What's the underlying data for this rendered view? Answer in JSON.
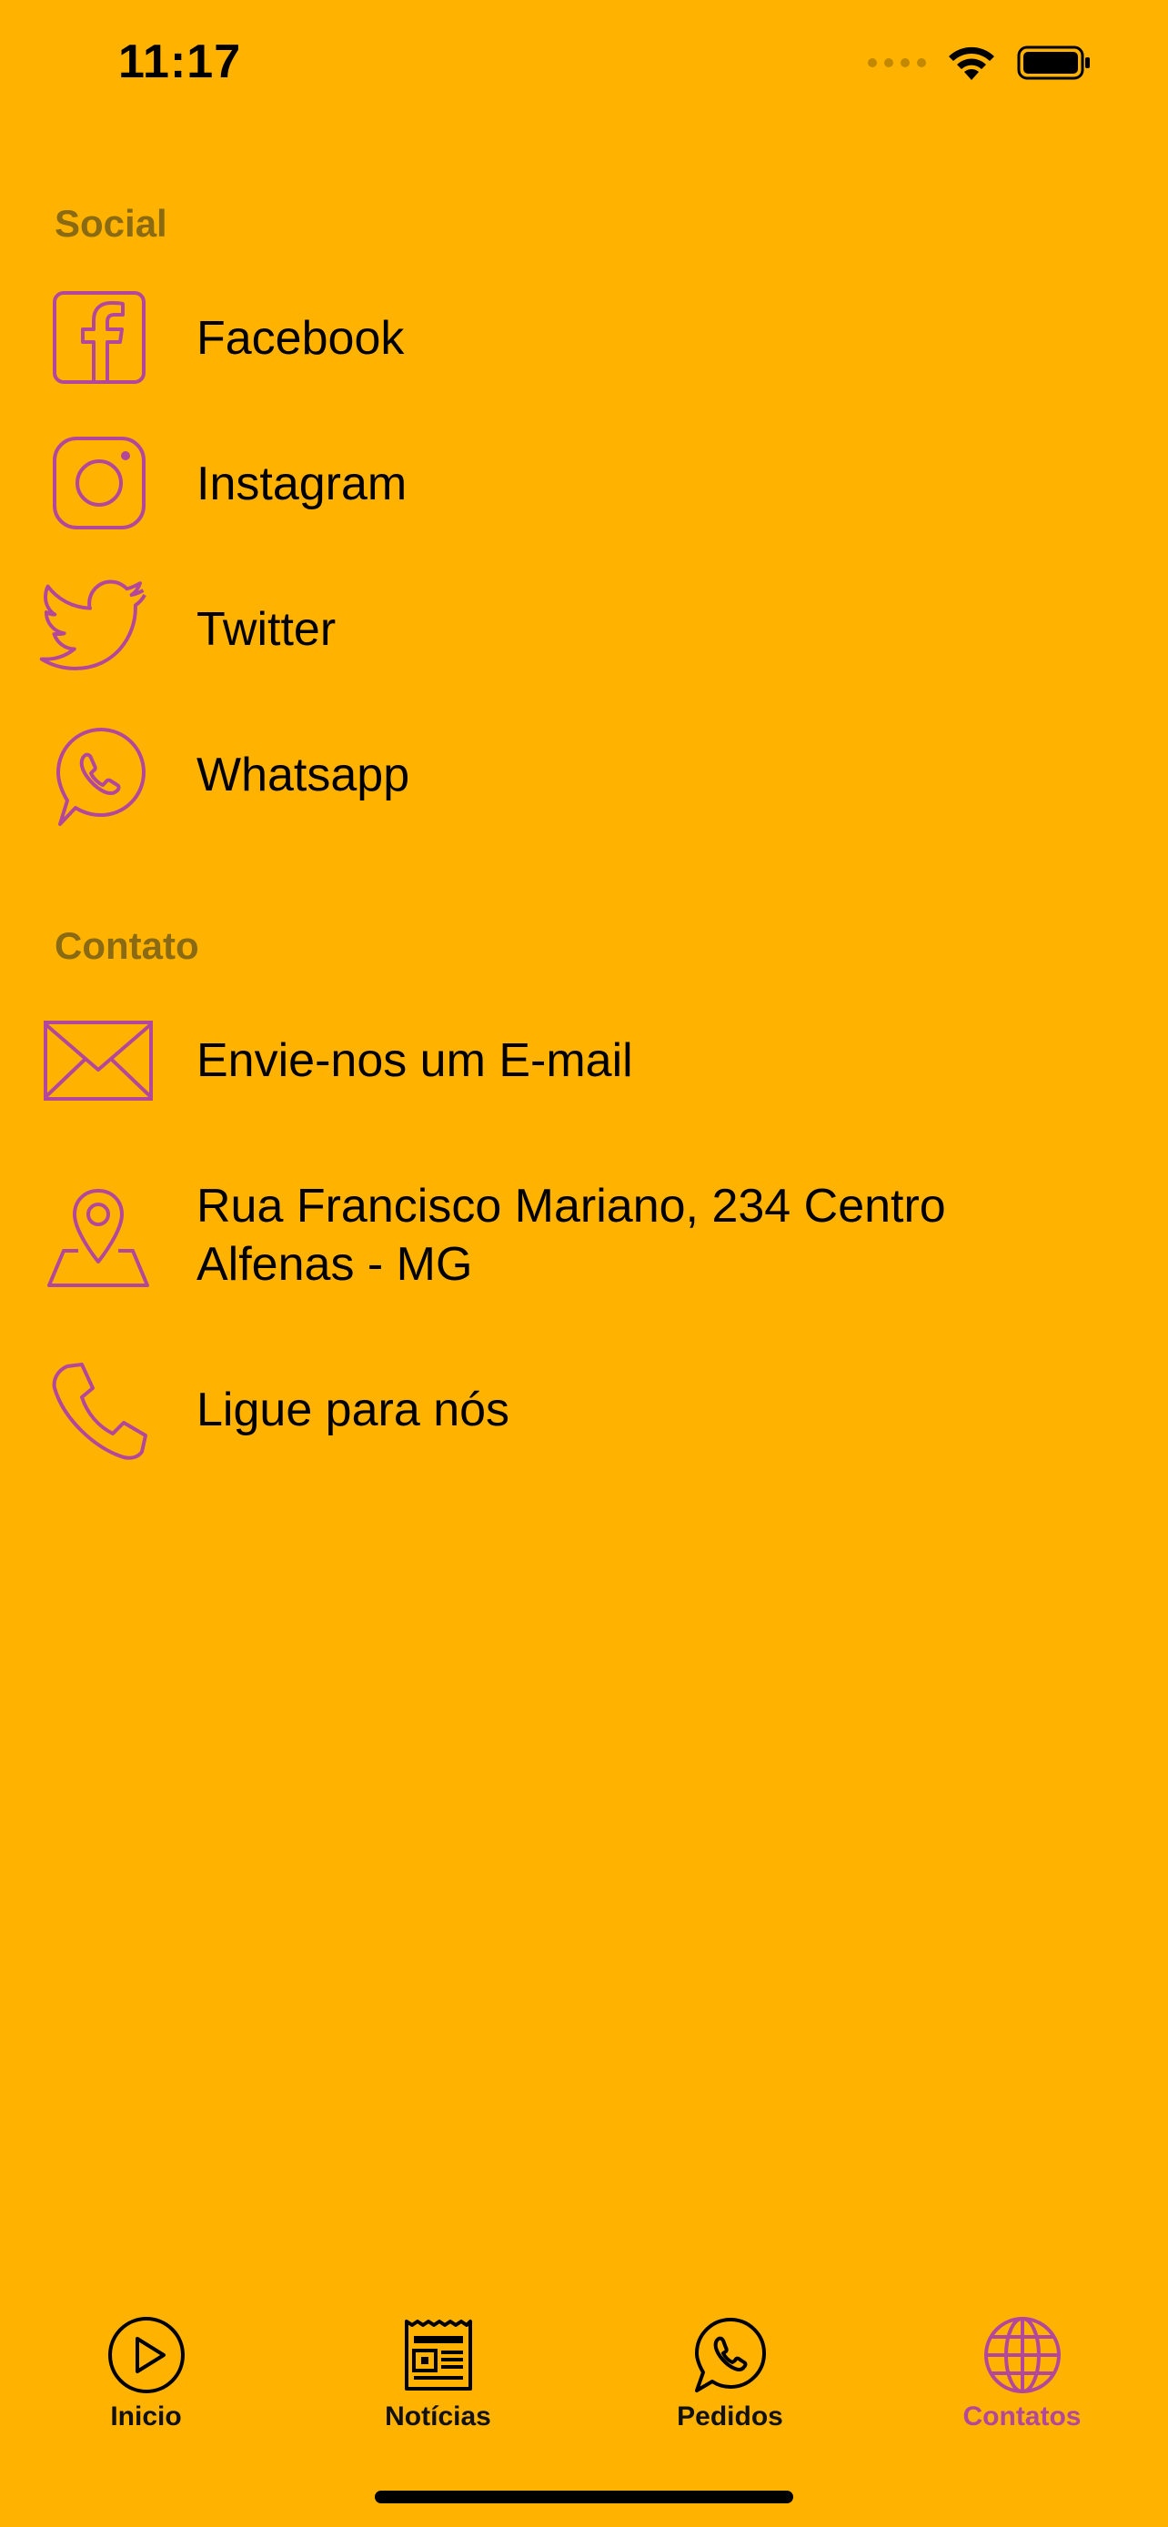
{
  "status_bar": {
    "time": "11:17"
  },
  "colors": {
    "background": "#FFB300",
    "accent": "#B3479A",
    "section_header": "#8a6a12"
  },
  "social": {
    "header": "Social",
    "items": [
      {
        "label": "Facebook",
        "icon": "facebook-icon"
      },
      {
        "label": "Instagram",
        "icon": "instagram-icon"
      },
      {
        "label": "Twitter",
        "icon": "twitter-icon"
      },
      {
        "label": "Whatsapp",
        "icon": "whatsapp-icon"
      }
    ]
  },
  "contato": {
    "header": "Contato",
    "items": [
      {
        "label": "Envie-nos um E-mail",
        "icon": "mail-icon"
      },
      {
        "label": "Rua Francisco Mariano, 234 Centro Alfenas - MG",
        "icon": "location-pin-icon"
      },
      {
        "label": "Ligue para nós",
        "icon": "phone-icon"
      }
    ]
  },
  "tab_bar": {
    "tabs": [
      {
        "label": "Inicio",
        "icon": "play-icon",
        "active": false
      },
      {
        "label": "Notícias",
        "icon": "newspaper-icon",
        "active": false
      },
      {
        "label": "Pedidos",
        "icon": "whatsapp-icon",
        "active": false
      },
      {
        "label": "Contatos",
        "icon": "globe-icon",
        "active": true
      }
    ]
  }
}
